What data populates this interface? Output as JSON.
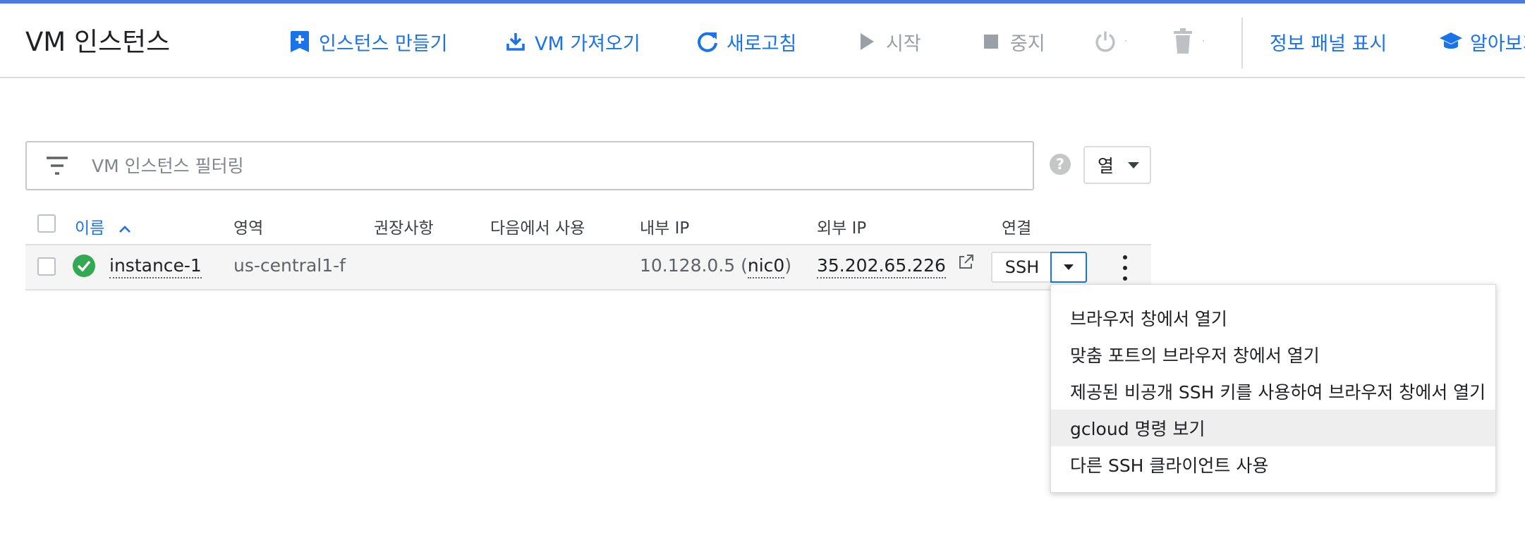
{
  "header": {
    "title": "VM 인스턴스",
    "toolbar": {
      "create_label": "인스턴스 만들기",
      "import_label": "VM 가져오기",
      "refresh_label": "새로고침",
      "start_label": "시작",
      "stop_label": "중지",
      "info_panel_label": "정보 패널 표시",
      "learn_label": "알아보기"
    }
  },
  "filter": {
    "placeholder": "VM 인스턴스 필터링",
    "value": ""
  },
  "columns_button": {
    "label": "열"
  },
  "table": {
    "headers": {
      "name": "이름",
      "zone": "영역",
      "recommendation": "권장사항",
      "in_use_by": "다음에서 사용",
      "internal_ip": "내부 IP",
      "external_ip": "외부 IP",
      "connect": "연결"
    },
    "rows": [
      {
        "status": "running",
        "name": "instance-1",
        "zone": "us-central1-f",
        "recommendation": "",
        "in_use_by": "",
        "internal_ip": "10.128.0.5 (",
        "nic": "nic0",
        "internal_ip_suffix": ")",
        "external_ip": "35.202.65.226",
        "connect_label": "SSH"
      }
    ]
  },
  "ssh_menu": {
    "items": [
      {
        "label": "브라우저 창에서 열기"
      },
      {
        "label": "맞춤 포트의 브라우저 창에서 열기"
      },
      {
        "label": "제공된 비공개 SSH 키를 사용하여 브라우저 창에서 열기"
      },
      {
        "label": "gcloud 명령 보기"
      },
      {
        "label": "다른 SSH 클라이언트 사용"
      }
    ],
    "highlighted_index": 3
  },
  "colors": {
    "accent": "#1a73e8",
    "status_ok": "#34a853",
    "disabled": "#9aa0a6"
  }
}
